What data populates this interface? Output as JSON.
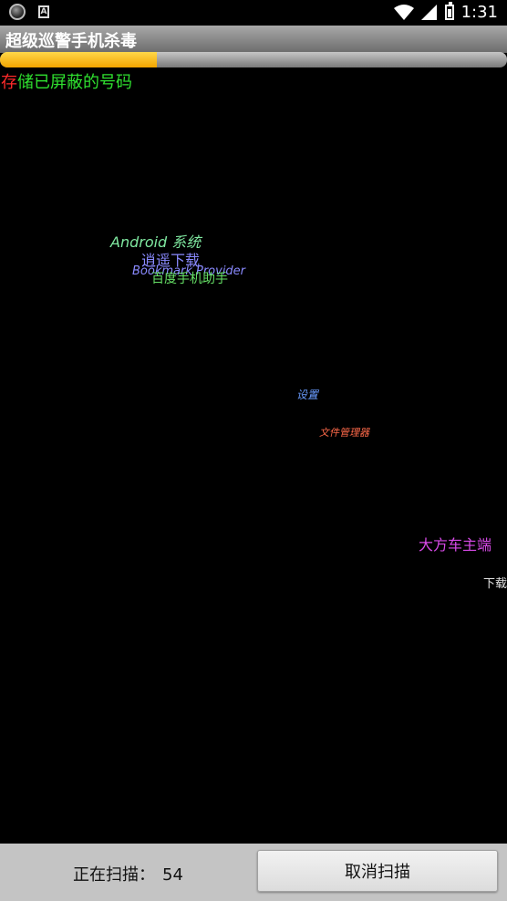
{
  "status_bar": {
    "time": "1:31",
    "a_icon_text": "A"
  },
  "app": {
    "title": "超级巡警手机杀毒"
  },
  "progress": {
    "fraction": 0.31
  },
  "stored": {
    "first_char": "存",
    "rest": "储已屏蔽的号码"
  },
  "floating_apps": [
    {
      "label": "Android 系统",
      "color": "#7fe8a0",
      "style": "italic"
    },
    {
      "label": "逍遥下载",
      "color": "#8a8aff",
      "style": "normal"
    },
    {
      "label": "Bookmark Provider",
      "color": "#8a8aff",
      "style": "italic"
    },
    {
      "label": "百度手机助手",
      "color": "#66e066",
      "style": "normal"
    },
    {
      "label": "设置",
      "color": "#6a9cff",
      "style": "italic"
    },
    {
      "label": "文件管理器",
      "color": "#ff6a4a",
      "style": "italic"
    },
    {
      "label": "大方车主端",
      "color": "#d84ae8",
      "style": "normal"
    },
    {
      "label": "下载",
      "color": "#e0e0e0",
      "style": "normal"
    }
  ],
  "footer": {
    "scan_label": "正在扫描：",
    "scan_count": "54",
    "cancel_label": "取消扫描"
  }
}
